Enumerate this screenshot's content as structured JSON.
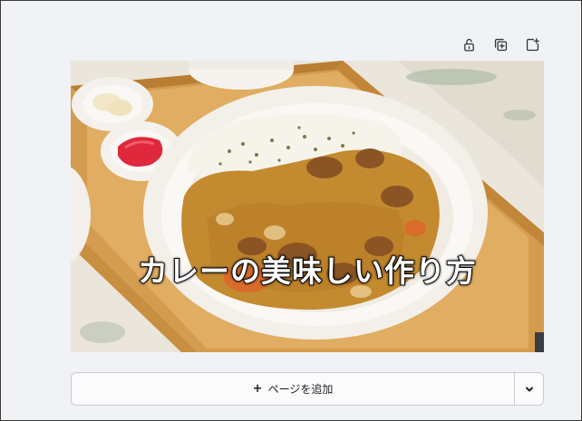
{
  "toolbar": {
    "icons": [
      "lock-open-icon",
      "duplicate-page-icon",
      "add-page-icon"
    ]
  },
  "canvas": {
    "title_text": "カレーの美味しい作り方"
  },
  "add_page": {
    "plus": "+",
    "label": "ページを追加",
    "dropdown_icon": "chevron-down-icon"
  },
  "colors": {
    "page_background": "#f1f2f6",
    "tray": "#d39a4a",
    "curry": "#c58a2e",
    "rice": "#f4f1e8",
    "plate": "#f7f5f0",
    "text_stroke": "#111111"
  }
}
